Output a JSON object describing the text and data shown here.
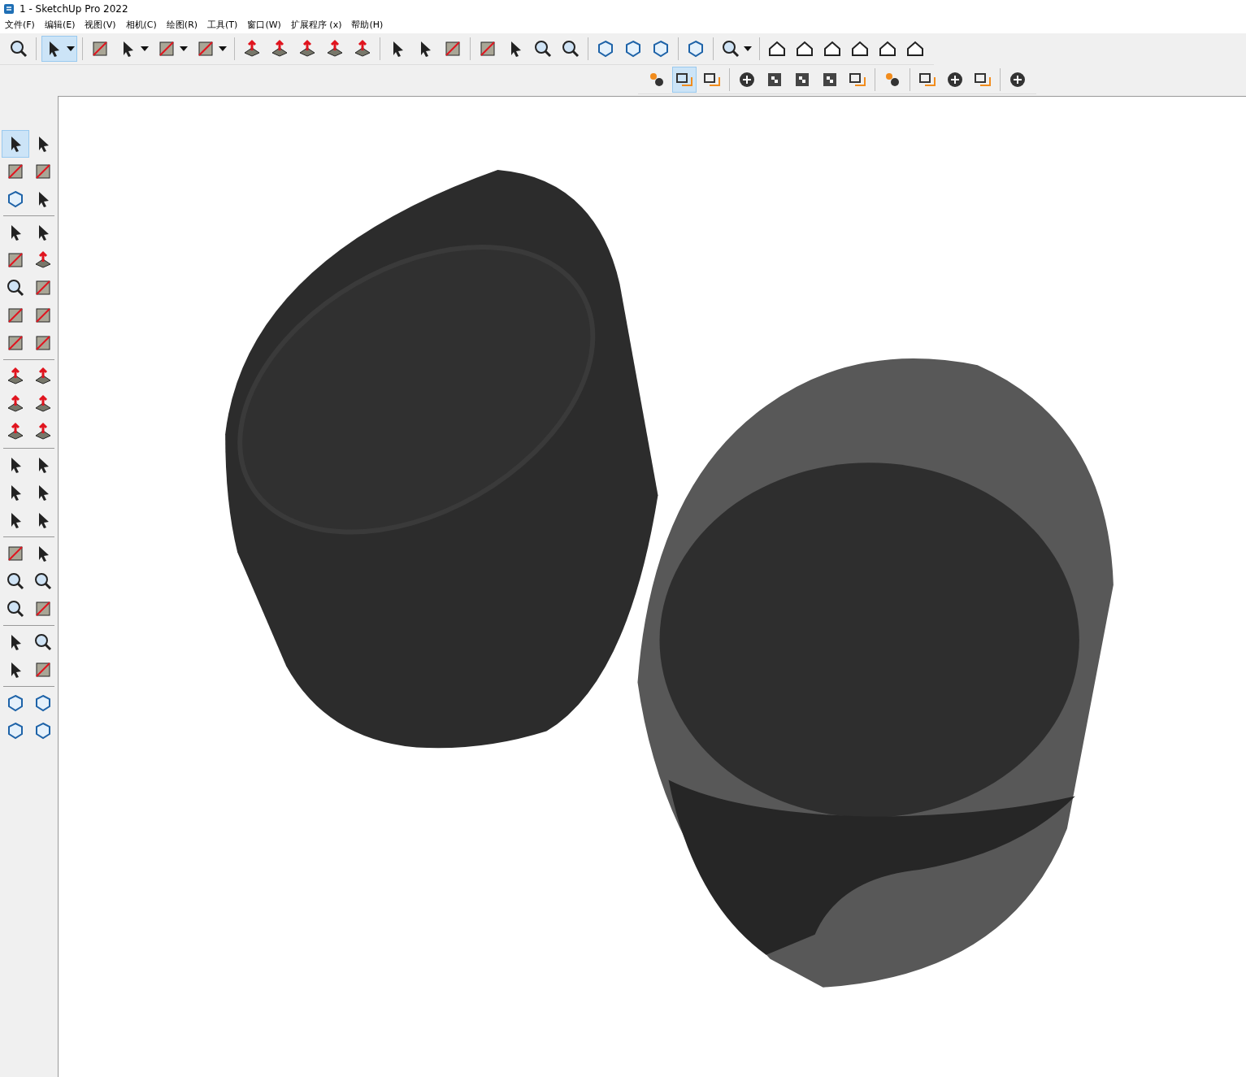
{
  "window": {
    "title": "1 - SketchUp Pro 2022"
  },
  "menu": [
    "文件(F)",
    "编辑(E)",
    "视图(V)",
    "相机(C)",
    "绘图(R)",
    "工具(T)",
    "窗口(W)",
    "扩展程序 (x)",
    "帮助(H)"
  ],
  "toolbar_main": {
    "groups": [
      [
        {
          "selected": false,
          "has_menu": false
        }
      ],
      [
        {
          "selected": true,
          "has_menu": true
        }
      ],
      [
        {
          "selected": false,
          "has_menu": false
        },
        {
          "selected": false,
          "has_menu": true
        },
        {
          "selected": false,
          "has_menu": true
        },
        {
          "selected": false,
          "has_menu": true
        }
      ],
      [
        {
          "selected": false,
          "has_menu": false
        },
        {
          "selected": false,
          "has_menu": false
        },
        {
          "selected": false,
          "has_menu": false
        },
        {
          "selected": false,
          "has_menu": false
        },
        {
          "selected": false,
          "has_menu": false
        }
      ],
      [
        {
          "selected": false,
          "has_menu": false
        },
        {
          "selected": false,
          "has_menu": false
        },
        {
          "selected": false,
          "has_menu": false
        }
      ],
      [
        {
          "selected": false,
          "has_menu": false
        },
        {
          "selected": false,
          "has_menu": false
        },
        {
          "selected": false,
          "has_menu": false
        },
        {
          "selected": false,
          "has_menu": false
        }
      ],
      [
        {
          "selected": false,
          "has_menu": false
        },
        {
          "selected": false,
          "has_menu": false
        },
        {
          "selected": false,
          "has_menu": false
        }
      ],
      [
        {
          "selected": false,
          "has_menu": false
        }
      ],
      [
        {
          "selected": false,
          "has_menu": true
        }
      ],
      [
        {
          "selected": false,
          "has_menu": false
        },
        {
          "selected": false,
          "has_menu": false
        },
        {
          "selected": false,
          "has_menu": false
        },
        {
          "selected": false,
          "has_menu": false
        },
        {
          "selected": false,
          "has_menu": false
        },
        {
          "selected": false,
          "has_menu": false
        }
      ]
    ]
  },
  "toolbar_second": {
    "groups": [
      [
        {
          "selected": false
        },
        {
          "selected": true
        },
        {
          "selected": false
        }
      ],
      [
        {
          "selected": false
        },
        {
          "selected": false
        },
        {
          "selected": false
        },
        {
          "selected": false
        },
        {
          "selected": false
        }
      ],
      [
        {
          "selected": false
        }
      ],
      [
        {
          "selected": false
        },
        {
          "selected": false
        },
        {
          "selected": false
        }
      ],
      [
        {
          "selected": false
        }
      ]
    ]
  },
  "toolbar_left": {
    "groups": [
      [
        {
          "selected": true
        },
        {
          "selected": false
        },
        {
          "selected": false
        },
        {
          "selected": false
        },
        {
          "selected": false
        },
        {
          "selected": false
        }
      ],
      [
        {
          "selected": false
        },
        {
          "selected": false
        },
        {
          "selected": false
        },
        {
          "selected": false
        },
        {
          "selected": false
        },
        {
          "selected": false
        },
        {
          "selected": false
        },
        {
          "selected": false
        },
        {
          "selected": false
        },
        {
          "selected": false
        }
      ],
      [
        {
          "selected": false
        },
        {
          "selected": false
        },
        {
          "selected": false
        },
        {
          "selected": false
        },
        {
          "selected": false
        },
        {
          "selected": false
        }
      ],
      [
        {
          "selected": false
        },
        {
          "selected": false
        },
        {
          "selected": false
        },
        {
          "selected": false
        },
        {
          "selected": false
        },
        {
          "selected": false
        }
      ],
      [
        {
          "selected": false
        },
        {
          "selected": false
        },
        {
          "selected": false
        },
        {
          "selected": false
        },
        {
          "selected": false
        },
        {
          "selected": false
        }
      ],
      [
        {
          "selected": false
        },
        {
          "selected": false
        },
        {
          "selected": false
        },
        {
          "selected": false
        }
      ],
      [
        {
          "selected": false
        },
        {
          "selected": false
        },
        {
          "selected": false
        },
        {
          "selected": false
        }
      ]
    ]
  }
}
